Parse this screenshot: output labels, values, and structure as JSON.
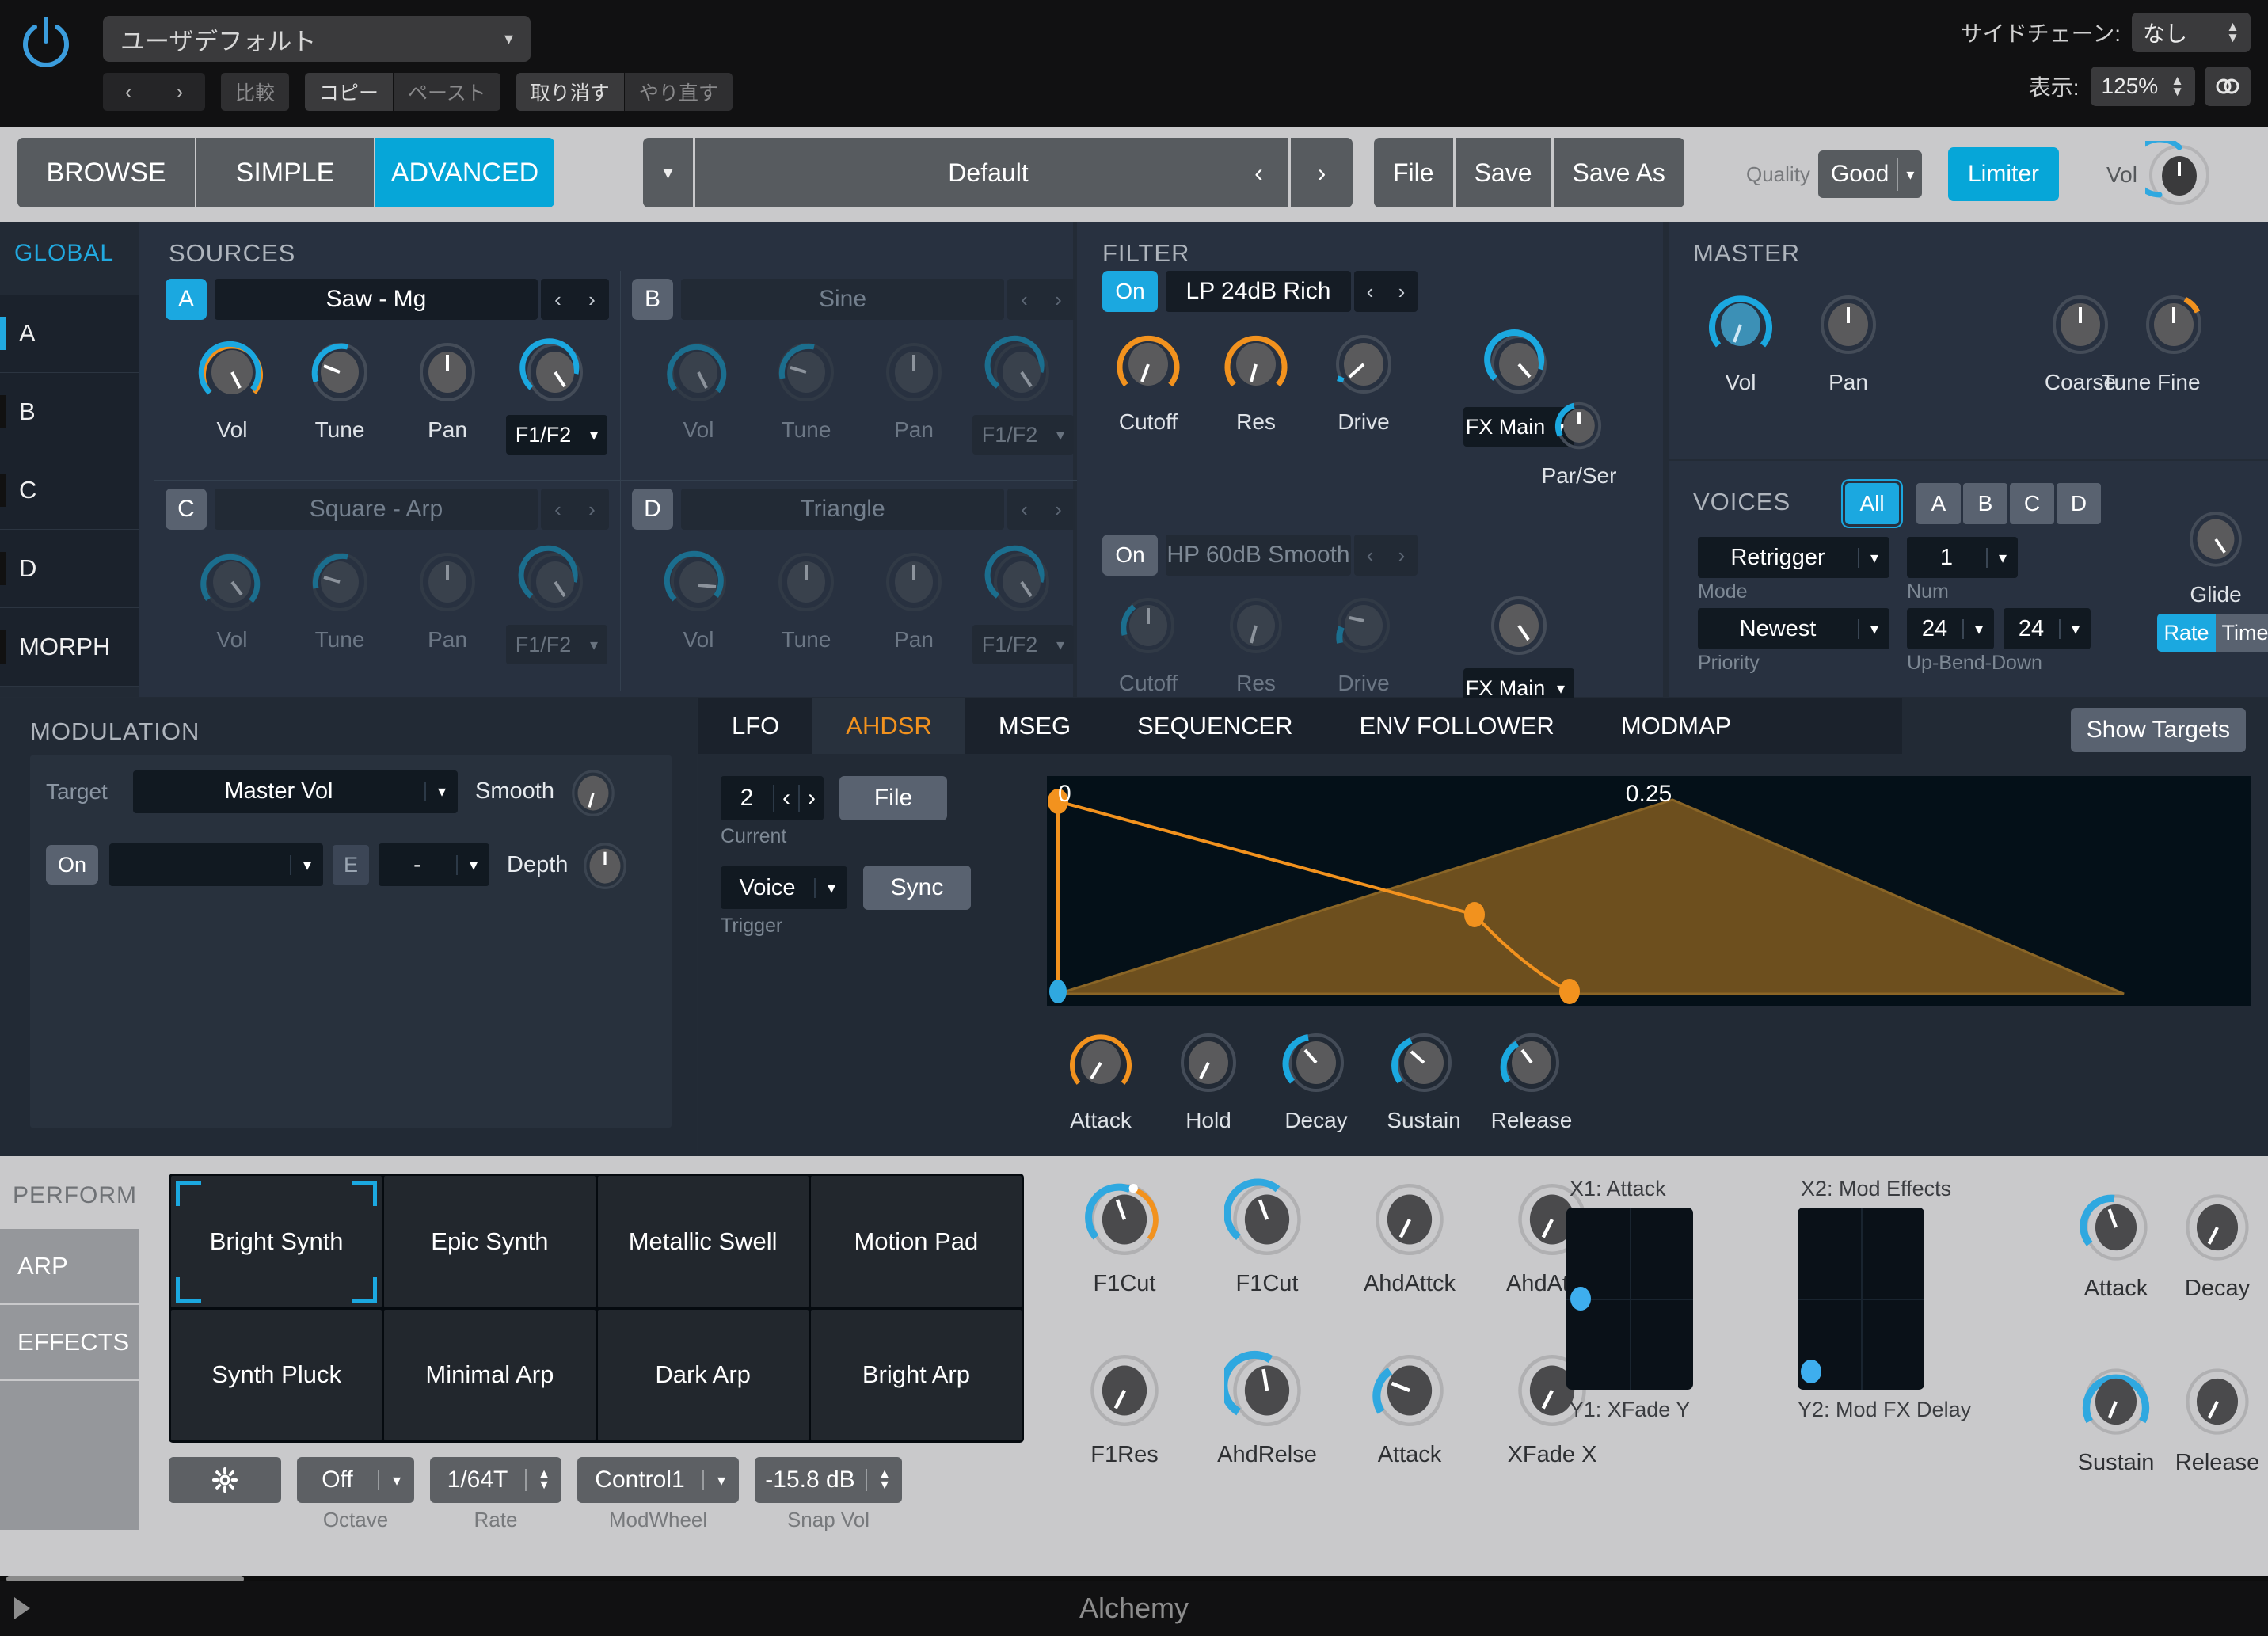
{
  "app": {
    "name": "Alchemy"
  },
  "titlebar": {
    "preset_user_default": "ユーザデフォルト",
    "prev_label": "‹",
    "next_label": "›",
    "compare_label": "比較",
    "copy_label": "コピー",
    "paste_label": "ペースト",
    "undo_label": "取り消す",
    "redo_label": "やり直す",
    "sidechain_label": "サイドチェーン:",
    "sidechain_value": "なし",
    "display_label": "表示:",
    "display_value": "125%"
  },
  "toolbar": {
    "modes": [
      {
        "label": "BROWSE",
        "active": false
      },
      {
        "label": "SIMPLE",
        "active": false
      },
      {
        "label": "ADVANCED",
        "active": true
      }
    ],
    "preset_name": "Default",
    "prev_label": "‹",
    "next_label": "›",
    "file_label": "File",
    "save_label": "Save",
    "save_as_label": "Save As",
    "quality_label": "Quality",
    "quality_value": "Good",
    "limiter_label": "Limiter",
    "vol_label": "Vol"
  },
  "global_sidebar": {
    "title": "GLOBAL",
    "items": [
      {
        "label": "A",
        "selected": true
      },
      {
        "label": "B",
        "selected": false
      },
      {
        "label": "C",
        "selected": false
      },
      {
        "label": "D",
        "selected": false
      },
      {
        "label": "MORPH",
        "selected": false
      }
    ]
  },
  "sources": {
    "title": "SOURCES",
    "knob_labels": {
      "vol": "Vol",
      "tune": "Tune",
      "pan": "Pan",
      "filter": "F1/F2"
    },
    "cells": [
      {
        "letter": "A",
        "name": "Saw - Mg",
        "active": true
      },
      {
        "letter": "B",
        "name": "Sine",
        "active": false
      },
      {
        "letter": "C",
        "name": "Square - Arp",
        "active": false
      },
      {
        "letter": "D",
        "name": "Triangle",
        "active": false
      }
    ]
  },
  "filter": {
    "title": "FILTER",
    "rows": [
      {
        "on_label": "On",
        "on": true,
        "name": "LP 24dB Rich",
        "cutoff": "Cutoff",
        "res": "Res",
        "drive": "Drive",
        "fx": "FX Main"
      },
      {
        "on_label": "On",
        "on": false,
        "name": "HP 60dB Smooth",
        "cutoff": "Cutoff",
        "res": "Res",
        "drive": "Drive",
        "fx": "FX Main"
      }
    ],
    "parser_label": "Par/Ser"
  },
  "master": {
    "title": "MASTER",
    "vol_label": "Vol",
    "pan_label": "Pan",
    "coarse_label": "Coarse",
    "tune_label": "Tune",
    "fine_label": "Fine"
  },
  "voices": {
    "title": "VOICES",
    "all_label": "All",
    "abcd": [
      "A",
      "B",
      "C",
      "D"
    ],
    "mode_value": "Retrigger",
    "mode_label": "Mode",
    "num_value": "1",
    "num_label": "Num",
    "priority_value": "Newest",
    "priority_label": "Priority",
    "bend_up": "24",
    "bend_down": "24",
    "bend_label": "Up-Bend-Down",
    "glide_label": "Glide",
    "rate_label": "Rate",
    "time_label": "Time"
  },
  "modulation": {
    "title": "MODULATION",
    "target_label": "Target",
    "target_value": "Master Vol",
    "smooth_label": "Smooth",
    "on_label": "On",
    "source_value": "",
    "e_label": "E",
    "dash_label": "-",
    "depth_label": "Depth"
  },
  "env": {
    "tabs": [
      {
        "label": "LFO",
        "active": false
      },
      {
        "label": "AHDSR",
        "active": true
      },
      {
        "label": "MSEG",
        "active": false
      },
      {
        "label": "SEQUENCER",
        "active": false
      },
      {
        "label": "ENV FOLLOWER",
        "active": false
      },
      {
        "label": "MODMAP",
        "active": false
      }
    ],
    "show_targets_label": "Show Targets",
    "current_value": "2",
    "current_label": "Current",
    "prev_label": "‹",
    "next_label": "›",
    "file_label": "File",
    "trigger_value": "Voice",
    "trigger_label": "Trigger",
    "sync_label": "Sync",
    "graph_left_value": "0",
    "graph_right_value": "0.25",
    "knobs": [
      "Attack",
      "Hold",
      "Decay",
      "Sustain",
      "Release"
    ]
  },
  "perform": {
    "title": "PERFORM",
    "side_items": [
      "ARP",
      "EFFECTS",
      ""
    ],
    "pads": [
      {
        "label": "Bright Synth",
        "selected": true
      },
      {
        "label": "Epic Synth",
        "selected": false
      },
      {
        "label": "Metallic Swell",
        "selected": false
      },
      {
        "label": "Motion Pad",
        "selected": false
      },
      {
        "label": "Synth Pluck",
        "selected": false
      },
      {
        "label": "Minimal Arp",
        "selected": false
      },
      {
        "label": "Dark Arp",
        "selected": false
      },
      {
        "label": "Bright Arp",
        "selected": false
      }
    ],
    "gear_icon": "gear-icon",
    "controls": [
      {
        "value": "Off",
        "label": "Octave",
        "kind": "drop"
      },
      {
        "value": "1/64T",
        "label": "Rate",
        "kind": "step"
      },
      {
        "value": "Control1",
        "label": "ModWheel",
        "kind": "drop"
      },
      {
        "value": "-15.8 dB",
        "label": "Snap Vol",
        "kind": "step"
      }
    ],
    "perf_knobs_row1": [
      "F1Cut",
      "F1Cut",
      "AhdAttck",
      "AhdAttck"
    ],
    "perf_knobs_row2": [
      "F1Res",
      "AhdRelse",
      "Attack",
      "XFade X"
    ],
    "xy": [
      {
        "top": "X1: Attack",
        "bottom": "Y1: XFade Y"
      },
      {
        "top": "X2: Mod Effects",
        "bottom": "Y2: Mod FX Delay"
      }
    ],
    "adsr_knobs": [
      "Attack",
      "Decay",
      "Sustain",
      "Release"
    ]
  },
  "statusbar": {
    "title": "Alchemy"
  },
  "colors": {
    "accent_blue": "#1ba8e0",
    "accent_orange": "#f2921e",
    "panel": "#283140",
    "light": "#c9c9cb"
  }
}
